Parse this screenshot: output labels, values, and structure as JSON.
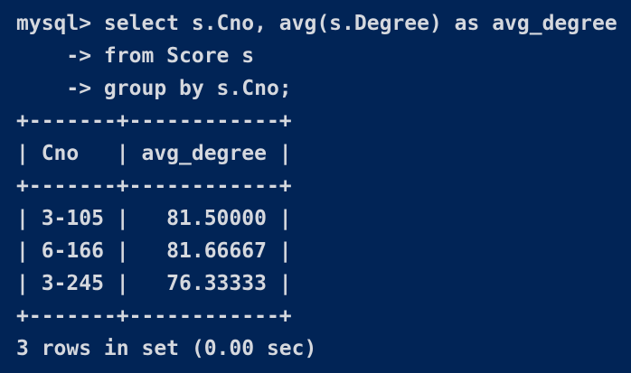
{
  "terminal": {
    "background": "#012456",
    "foreground": "#d5d8de",
    "lines": [
      "mysql> select s.Cno, avg(s.Degree) as avg_degree",
      "    -> from Score s",
      "    -> group by s.Cno;",
      "+-------+------------+",
      "| Cno   | avg_degree |",
      "+-------+------------+",
      "| 3-105 |   81.50000 |",
      "| 6-166 |   81.66667 |",
      "| 3-245 |   76.33333 |",
      "+-------+------------+",
      "3 rows in set (0.00 sec)"
    ]
  }
}
